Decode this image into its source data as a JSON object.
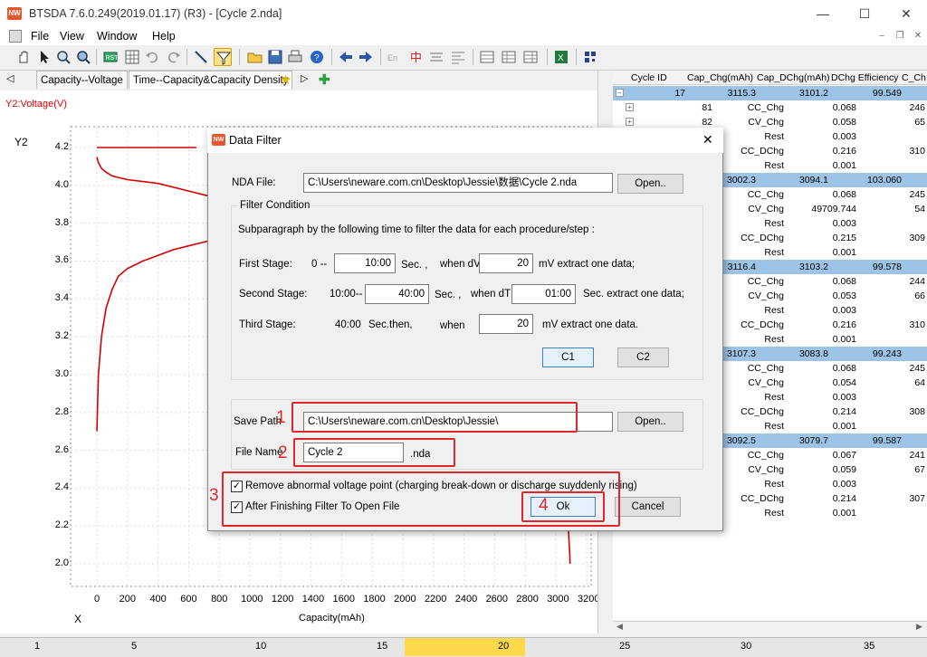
{
  "window": {
    "title": "BTSDA 7.6.0.249(2019.01.17) (R3) - [Cycle 2.nda]",
    "app_icon": "NW",
    "minimize": "—",
    "maximize": "☐",
    "close": "✕"
  },
  "menu": {
    "items": [
      "File",
      "View",
      "Window",
      "Help"
    ]
  },
  "mdi_controls": [
    "–",
    "❐",
    "✕"
  ],
  "tabs": [
    "Capacity--Voltage",
    "Time--Capacity&Capacity Density"
  ],
  "tab_scroll_left": "◁",
  "tab_scroll_right": "▷",
  "chart": {
    "series_label": "Y2:Voltage(V)",
    "y_axis_title": "Y2",
    "x_axis_title": "X",
    "x_axis_label": "Capacity(mAh)",
    "y_ticks": [
      "4.2",
      "4.0",
      "3.8",
      "3.6",
      "3.4",
      "3.2",
      "3.0",
      "2.8",
      "2.6",
      "2.4",
      "2.2",
      "2.0"
    ],
    "x_ticks": [
      "0",
      "200",
      "400",
      "600",
      "800",
      "1000",
      "1200",
      "1400",
      "1600",
      "1800",
      "2000",
      "2200",
      "2400",
      "2600",
      "2800",
      "3000",
      "3200"
    ],
    "line_color": "#d40000"
  },
  "chart_data": {
    "type": "line",
    "xlabel": "Capacity(mAh)",
    "ylabel": "Y2",
    "xlim": [
      -80,
      3250
    ],
    "ylim": [
      1.95,
      4.27
    ],
    "series": [
      {
        "name": "Y2:Voltage(V)",
        "x": [
          0,
          10,
          30,
          60,
          100,
          140,
          200,
          300,
          400,
          500,
          600,
          700,
          800
        ],
        "y": [
          2.7,
          3.0,
          3.2,
          3.35,
          3.45,
          3.52,
          3.56,
          3.6,
          3.63,
          3.66,
          3.68,
          3.7,
          3.72
        ]
      },
      {
        "name": "",
        "x": [
          0,
          10,
          30,
          60,
          100,
          150,
          200,
          300,
          400,
          500,
          600,
          700,
          800
        ],
        "y": [
          4.15,
          4.12,
          4.09,
          4.07,
          4.05,
          4.04,
          4.03,
          4.02,
          4.01,
          3.99,
          3.97,
          3.95,
          3.93
        ]
      },
      {
        "name": "",
        "x": [
          0,
          100,
          200,
          300,
          400,
          500,
          600,
          650
        ],
        "y": [
          4.2,
          4.2,
          4.2,
          4.2,
          4.2,
          4.2,
          4.2,
          4.2
        ]
      },
      {
        "name": "",
        "x": [
          3080,
          3085,
          3090,
          3092
        ],
        "y": [
          2.2,
          2.12,
          2.05,
          2.0
        ]
      }
    ]
  },
  "table": {
    "headers": [
      "Cycle ID",
      "Cap_Chg(mAh)",
      "Cap_DChg(mAh)",
      "DChg Efficiency",
      "C_Ch"
    ],
    "cycles": [
      {
        "id": "17",
        "cap_chg": "3115.3",
        "cap_dchg": "3101.2",
        "eff": "99.549",
        "steps": [
          {
            "id": "81",
            "name": "CC_Chg",
            "val": "0.068",
            "extra": "246"
          },
          {
            "id": "82",
            "name": "CV_Chg",
            "val": "0.058",
            "extra": "65"
          },
          {
            "id": "",
            "name": "Rest",
            "val": "0.003",
            "extra": ""
          },
          {
            "id": "",
            "name": "CC_DChg",
            "val": "0.216",
            "extra": "310"
          },
          {
            "id": "",
            "name": "Rest",
            "val": "0.001",
            "extra": ""
          }
        ]
      },
      {
        "id": "",
        "cap_chg": "3002.3",
        "cap_dchg": "3094.1",
        "eff": "103.060",
        "steps": [
          {
            "id": "",
            "name": "CC_Chg",
            "val": "0.068",
            "extra": "245"
          },
          {
            "id": "",
            "name": "CV_Chg",
            "val": "49709.744",
            "extra": "54"
          },
          {
            "id": "",
            "name": "Rest",
            "val": "0.003",
            "extra": ""
          },
          {
            "id": "",
            "name": "CC_DChg",
            "val": "0.215",
            "extra": "309"
          },
          {
            "id": "",
            "name": "Rest",
            "val": "0.001",
            "extra": ""
          }
        ]
      },
      {
        "id": "",
        "cap_chg": "3116.4",
        "cap_dchg": "3103.2",
        "eff": "99.578",
        "steps": [
          {
            "id": "",
            "name": "CC_Chg",
            "val": "0.068",
            "extra": "244"
          },
          {
            "id": "",
            "name": "CV_Chg",
            "val": "0.053",
            "extra": "66"
          },
          {
            "id": "",
            "name": "Rest",
            "val": "0.003",
            "extra": ""
          },
          {
            "id": "",
            "name": "CC_DChg",
            "val": "0.216",
            "extra": "310"
          },
          {
            "id": "",
            "name": "Rest",
            "val": "0.001",
            "extra": ""
          }
        ]
      },
      {
        "id": "",
        "cap_chg": "3107.3",
        "cap_dchg": "3083.8",
        "eff": "99.243",
        "steps": [
          {
            "id": "",
            "name": "CC_Chg",
            "val": "0.068",
            "extra": "245"
          },
          {
            "id": "",
            "name": "CV_Chg",
            "val": "0.054",
            "extra": "64"
          },
          {
            "id": "",
            "name": "Rest",
            "val": "0.003",
            "extra": ""
          },
          {
            "id": "",
            "name": "CC_DChg",
            "val": "0.214",
            "extra": "308"
          },
          {
            "id": "",
            "name": "Rest",
            "val": "0.001",
            "extra": ""
          }
        ]
      },
      {
        "id": "",
        "cap_chg": "3092.5",
        "cap_dchg": "3079.7",
        "eff": "99.587",
        "steps": [
          {
            "id": "",
            "name": "CC_Chg",
            "val": "0.067",
            "extra": "241"
          },
          {
            "id": "",
            "name": "CV_Chg",
            "val": "0.059",
            "extra": "67"
          },
          {
            "id": "",
            "name": "Rest",
            "val": "0.003",
            "extra": ""
          },
          {
            "id": "",
            "name": "CC_DChg",
            "val": "0.214",
            "extra": "307"
          },
          {
            "id": "",
            "name": "Rest",
            "val": "0.001",
            "extra": ""
          }
        ]
      }
    ]
  },
  "ruler": {
    "ticks": [
      "1",
      "5",
      "10",
      "15",
      "20",
      "25",
      "30",
      "35"
    ]
  },
  "dialog": {
    "title": "Data Filter",
    "close": "✕",
    "nda_file_label": "NDA File:",
    "nda_file_value": "C:\\Users\\neware.com.cn\\Desktop\\Jessie\\数据\\Cycle 2.nda",
    "open_button": "Open..",
    "filter_condition_label": "Filter Condition",
    "subparagraph_text": "Subparagraph by the following time to filter the data for each procedure/step :",
    "first_stage": {
      "label": "First Stage:",
      "range_start": "0 --",
      "time": "10:00",
      "sec": "Sec. ,",
      "when": "when dV",
      "value": "20",
      "suffix": "mV extract one data;"
    },
    "second_stage": {
      "label": "Second Stage:",
      "range_start": "10:00--",
      "time": "40:00",
      "sec": "Sec. ,",
      "when": "when dT",
      "value": "01:00",
      "suffix": "Sec. extract one data;"
    },
    "third_stage": {
      "label": "Third Stage:",
      "range_start": "40:00",
      "sec": "Sec.then,",
      "when": "when",
      "value": "20",
      "suffix": "mV extract one data."
    },
    "c1_button": "C1",
    "c2_button": "C2",
    "save_path_label": "Save Path",
    "save_path_value": "C:\\Users\\neware.com.cn\\Desktop\\Jessie\\",
    "save_open_button": "Open..",
    "file_name_label": "File Name",
    "file_name_value": "Cycle 2",
    "file_ext": ".nda",
    "remove_abnormal_label": "Remove abnormal voltage point (charging break-down or discharge suyddenly rising)",
    "remove_abnormal_checked": true,
    "open_after_label": "After Finishing Filter To Open File",
    "open_after_checked": true,
    "ok_button": "Ok",
    "cancel_button": "Cancel"
  },
  "annotations": {
    "n1": "1",
    "n2": "2",
    "n3": "3",
    "n4": "4",
    "color": "#e0262c"
  }
}
